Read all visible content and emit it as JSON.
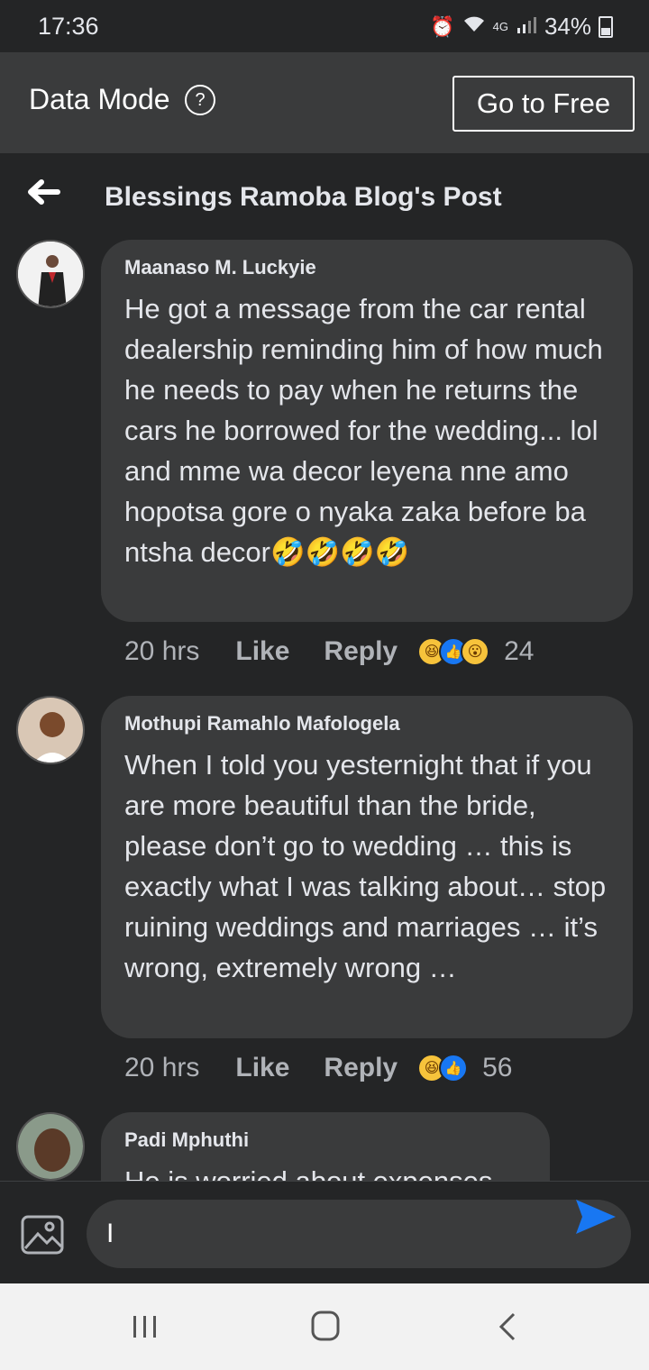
{
  "status_bar": {
    "time": "17:36",
    "network": "4G",
    "battery": "34%"
  },
  "data_mode": {
    "label": "Data Mode",
    "help": "?",
    "go_free": "Go to Free"
  },
  "header": {
    "title": "Blessings Ramoba Blog's Post"
  },
  "comments": [
    {
      "author": "Maanaso M. Luckyie",
      "text": "He got a message from the car rental dealership reminding him of how much he needs to pay when he returns the cars he borrowed for the wedding... lol and mme wa decor leyena nne amo hopotsa gore o nyaka zaka before ba ntsha decor🤣🤣🤣🤣",
      "time": "20 hrs",
      "like": "Like",
      "reply": "Reply",
      "reactions": [
        "haha",
        "like",
        "wow"
      ],
      "count": "24"
    },
    {
      "author": "Mothupi Ramahlo Mafologela",
      "text": "When I told you yesternight that if you are more beautiful than the bride, please don’t go to wedding … this is exactly what I was talking about… stop ruining weddings and marriages … it’s wrong, extremely wrong …",
      "time": "20 hrs",
      "like": "Like",
      "reply": "Reply",
      "reactions": [
        "haha",
        "like"
      ],
      "count": "56"
    },
    {
      "author": "Padi Mphuthi",
      "text": "He is worried about expenses"
    }
  ],
  "composer": {
    "value": "I"
  },
  "colors": {
    "background": "#242526",
    "bubble": "#3a3b3c",
    "accent": "#1877f2"
  }
}
